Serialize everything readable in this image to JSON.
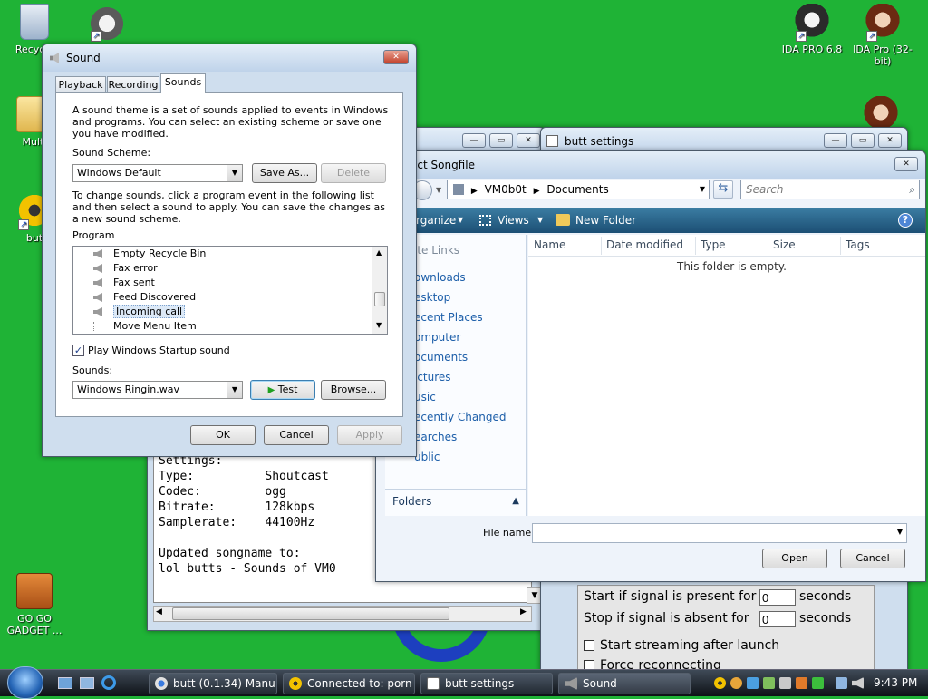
{
  "desktop": {
    "icons": [
      {
        "label": "Recycle"
      },
      {
        "label": ""
      },
      {
        "label": "Multi"
      },
      {
        "label": "but"
      },
      {
        "label": "GO GO GADGET ..."
      },
      {
        "label": "IDA PRO 6.8"
      },
      {
        "label": "IDA Pro (32-bit)"
      }
    ]
  },
  "sound_dialog": {
    "title": "Sound",
    "tabs": [
      "Playback",
      "Recording",
      "Sounds"
    ],
    "active_tab": "Sounds",
    "intro": "A sound theme is a set of sounds applied to events in Windows and programs.  You can select an existing scheme or save one you have modified.",
    "scheme_label": "Sound Scheme:",
    "scheme_value": "Windows Default",
    "save_as": "Save As...",
    "delete": "Delete",
    "instructions": "To change sounds, click a program event in the following list and then select a sound to apply.  You can save the changes as a new sound scheme.",
    "program_label": "Program",
    "program_items": [
      "Empty Recycle Bin",
      "Fax error",
      "Fax sent",
      "Feed Discovered",
      "Incoming call",
      "Move Menu Item"
    ],
    "selected_item": "Incoming call",
    "startup_checkbox_label": "Play Windows Startup sound",
    "startup_checked": true,
    "sounds_label": "Sounds:",
    "sound_value": "Windows Ringin.wav",
    "test": "Test",
    "browse": "Browse...",
    "ok": "OK",
    "cancel": "Cancel",
    "apply": "Apply"
  },
  "butt_log": {
    "lines": [
      "Settings:",
      "Type:          Shoutcast",
      "Codec:         ogg",
      "Bitrate:       128kbps",
      "Samplerate:    44100Hz",
      "",
      "Updated songname to:",
      "lol butts - Sounds of VM0"
    ]
  },
  "butt_settings": {
    "title": "butt settings",
    "start_signal_label": "Start if signal is present for",
    "start_signal_value": "0",
    "stop_signal_label": "Stop if signal is absent for",
    "stop_signal_value": "0",
    "seconds": "seconds",
    "start_streaming_label": "Start streaming after launch",
    "force_reconnect_label": "Force reconnecting"
  },
  "songfile_dialog": {
    "title": "ect Songfile",
    "breadcrumb": [
      "VM0b0t",
      "Documents"
    ],
    "search_placeholder": "Search",
    "toolbar": {
      "organize": "rganize",
      "views": "Views",
      "new_folder": "New Folder"
    },
    "nav_header": "ite Links",
    "nav_items": [
      "ownloads",
      "esktop",
      "ecent Places",
      "omputer",
      "ocuments",
      "ictures",
      "usic",
      "ecently Changed",
      "earches",
      "ublic"
    ],
    "folders_label": "Folders",
    "columns": [
      "Name",
      "Date modified",
      "Type",
      "Size",
      "Tags"
    ],
    "empty_message": "This folder is empty.",
    "filename_label": "File name:",
    "open": "Open",
    "cancel": "Cancel"
  },
  "taskbar": {
    "items": [
      "butt (0.1.34) Manu...",
      "Connected to: porn",
      "butt settings",
      "Sound"
    ],
    "active_item": "Sound",
    "clock": "9:43 PM"
  },
  "colors": {
    "desktop": "#1fb336",
    "selection": "#dce9f7"
  }
}
